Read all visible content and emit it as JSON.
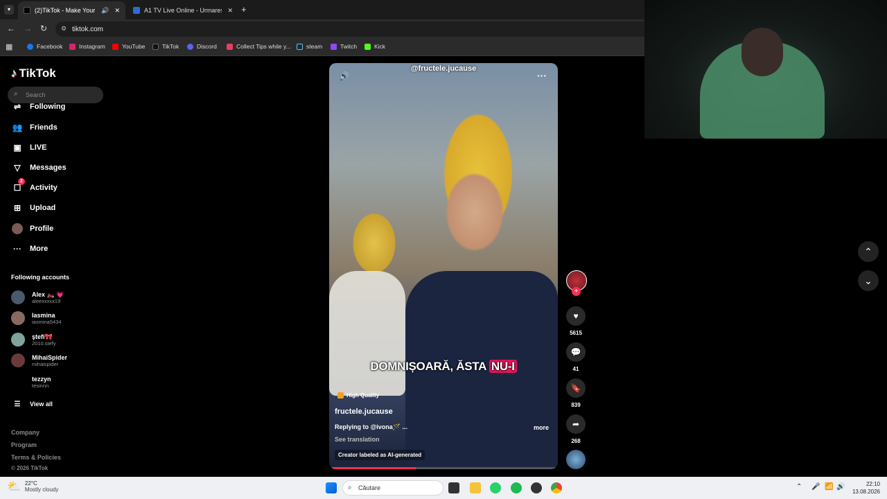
{
  "browser": {
    "tabs": [
      {
        "label": "(2)TikTok - Make Your Day",
        "active": true
      },
      {
        "label": "A1 TV Live Online - Urmareste",
        "active": false
      }
    ],
    "url": "tiktok.com",
    "bookmarks": [
      "Facebook",
      "Instagram",
      "YouTube",
      "TikTok",
      "Discord",
      "Collect Tips while y...",
      "steam",
      "Twitch",
      "Kick"
    ]
  },
  "sidebar": {
    "logo": "TikTok",
    "search_placeholder": "Search",
    "nav": [
      {
        "label": "Following",
        "icon": "following-icon"
      },
      {
        "label": "Friends",
        "icon": "friends-icon"
      },
      {
        "label": "LIVE",
        "icon": "live-icon"
      },
      {
        "label": "Messages",
        "icon": "messages-icon"
      },
      {
        "label": "Activity",
        "icon": "activity-icon",
        "badge": "2"
      },
      {
        "label": "Upload",
        "icon": "upload-icon"
      },
      {
        "label": "Profile",
        "icon": "profile-icon"
      },
      {
        "label": "More",
        "icon": "more-icon"
      }
    ],
    "following_title": "Following accounts",
    "accounts": [
      {
        "name": "Alex 🏍️ 💗",
        "username": "aleexxxxx19"
      },
      {
        "name": "Iasmina",
        "username": "iasmina5434"
      },
      {
        "name": "ştefi🎀",
        "username": "2010.stefy"
      },
      {
        "name": "MihaiSpider",
        "username": "mihaispider"
      },
      {
        "name": "tezzyn",
        "username": "tesinnn"
      }
    ],
    "view_all": "View all",
    "footer": [
      "Company",
      "Program",
      "Terms & Policies",
      "© 2026 TikTok"
    ]
  },
  "video": {
    "handle_overlay": "@fructele.jucause",
    "caption_main": "DOMNIȘOARĂ, ĂSTA ",
    "caption_highlight": "NU-I",
    "quality_badge": "High Quality",
    "author": "fructele.jucause",
    "description": "Replying to @ivona🪄 ...",
    "more": "more",
    "see_translation": "See translation",
    "ai_label": "Creator labeled as AI-generated",
    "progress": 0.38
  },
  "actions": [
    {
      "name": "like",
      "count": "5615"
    },
    {
      "name": "comment",
      "count": "41"
    },
    {
      "name": "bookmark",
      "count": "839"
    },
    {
      "name": "share",
      "count": "268"
    }
  ],
  "taskbar": {
    "weather_temp": "22°C",
    "weather_desc": "Mostly cloudy",
    "search_placeholder": "Căutare",
    "time": "22:10",
    "date": "13.08.2026"
  },
  "colors": {
    "accent": "#fe2c55",
    "highlight": "#e8145a"
  }
}
